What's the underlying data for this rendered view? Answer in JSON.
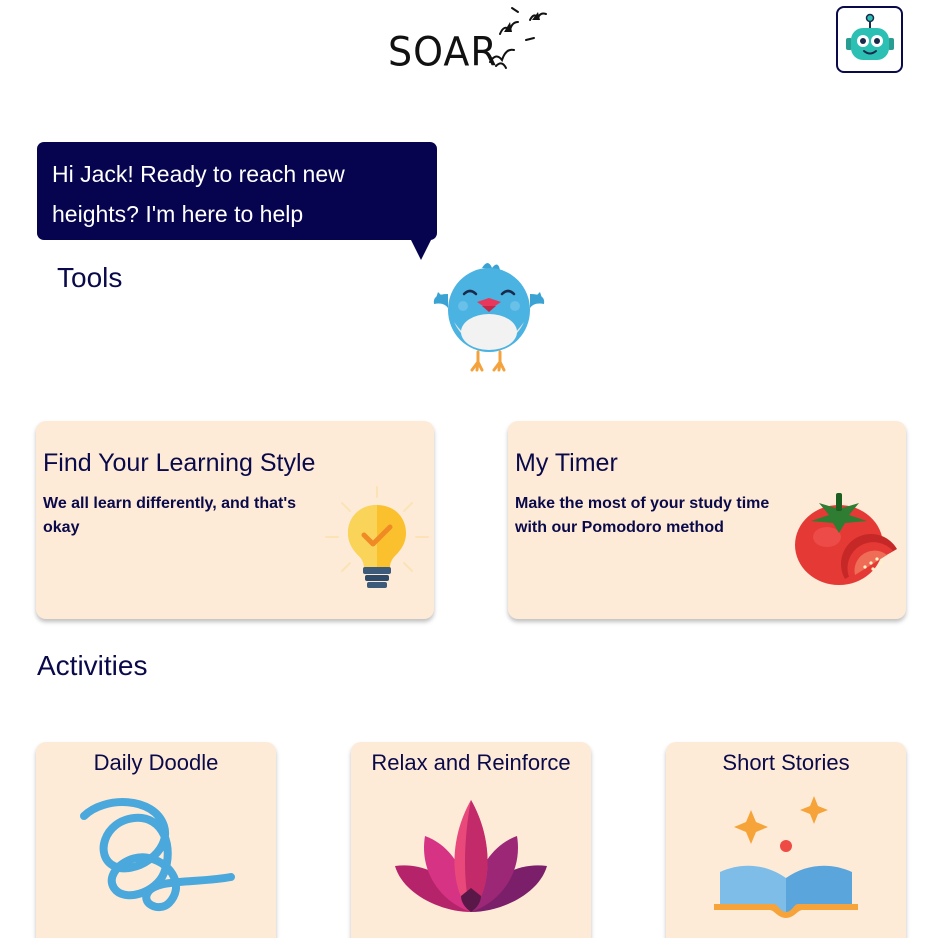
{
  "header": {
    "logo_text": "SOAR",
    "robot_icon": "robot-icon"
  },
  "assistant": {
    "message": "Hi Jack! Ready to reach new heights? I'm here to help",
    "mascot_icon": "bird-icon"
  },
  "tools": {
    "title": "Tools",
    "cards": [
      {
        "title": "Find Your Learning Style",
        "description": "We all learn differently, and that's okay",
        "icon": "lightbulb-icon"
      },
      {
        "title": "My Timer",
        "description": "Make the most of your study time with our Pomodoro method",
        "icon": "tomato-icon"
      }
    ]
  },
  "activities": {
    "title": "Activities",
    "cards": [
      {
        "title": "Daily Doodle",
        "icon": "doodle-icon"
      },
      {
        "title": "Relax and Reinforce",
        "icon": "lotus-icon"
      },
      {
        "title": "Short Stories",
        "icon": "open-book-icon"
      }
    ]
  },
  "colors": {
    "navy": "#06044f",
    "card_background": "#fdebd7"
  }
}
